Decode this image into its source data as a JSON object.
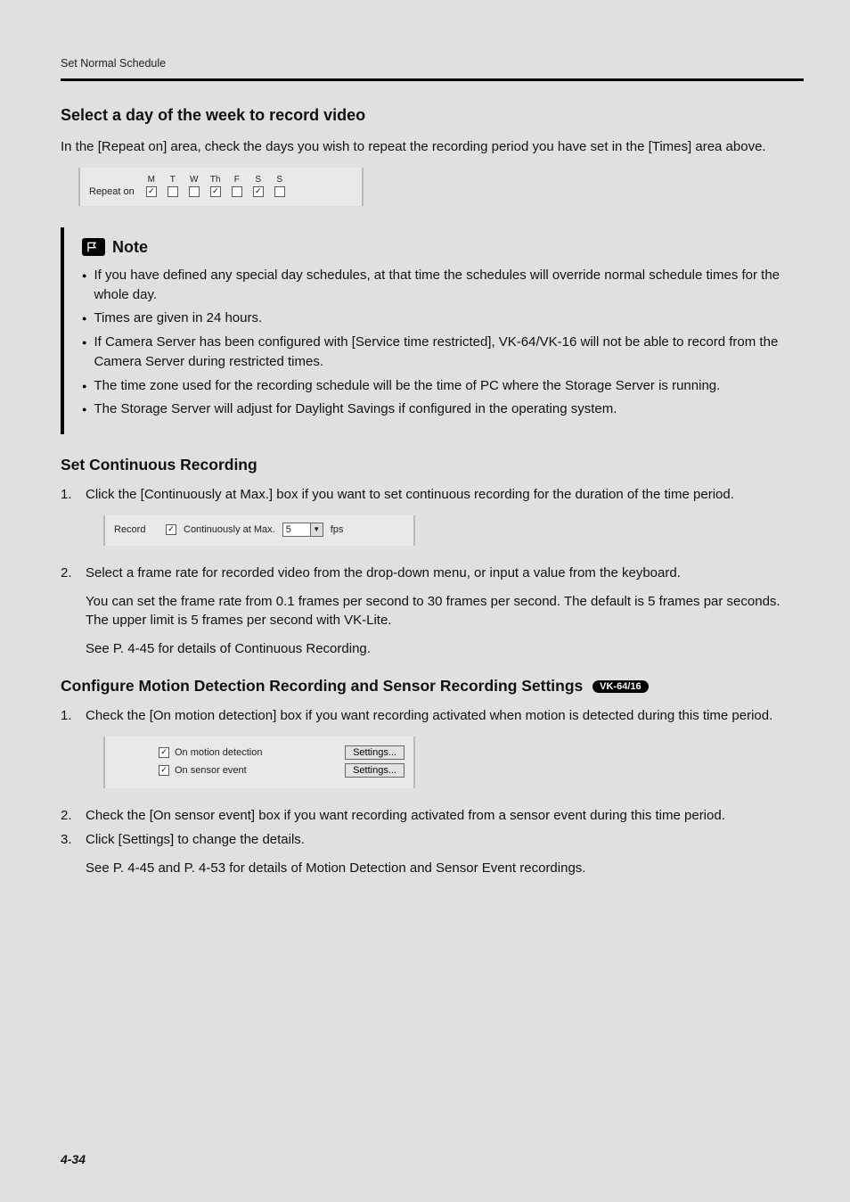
{
  "running_head": "Set Normal Schedule",
  "h_select_day": "Select a day of the week to record video",
  "p_select_day": "In the [Repeat on] area, check the days you wish to repeat the recording period you have set in the [Times] area above.",
  "repeat_shot": {
    "label": "Repeat on",
    "days": [
      {
        "abbr": "M",
        "checked": true
      },
      {
        "abbr": "T",
        "checked": false
      },
      {
        "abbr": "W",
        "checked": false
      },
      {
        "abbr": "Th",
        "checked": true
      },
      {
        "abbr": "F",
        "checked": false
      },
      {
        "abbr": "S",
        "checked": true
      },
      {
        "abbr": "S",
        "checked": false
      }
    ]
  },
  "note": {
    "title": "Note",
    "items": [
      "If you have defined any special day schedules, at that time the schedules will override normal schedule times for the whole day.",
      "Times are given in 24 hours.",
      "If Camera Server has been configured with [Service time restricted], VK-64/VK-16 will not be able to record from the Camera Server during restricted times.",
      "The time zone used for the recording schedule will be the time of PC where the Storage Server is running.",
      "The Storage Server will adjust for Daylight Savings if configured in the operating system."
    ]
  },
  "h_cont_rec": "Set Continuous Recording",
  "cont_steps": {
    "s1": "Click the [Continuously at Max.] box if you want to set continuous recording for the duration of the time period.",
    "s2": "Select a frame rate for recorded video from the drop-down menu, or input a value from the keyboard.",
    "s2_p1": "You can set the frame rate from 0.1 frames per second to 30 frames per second. The default is 5 frames par seconds. The upper limit is 5 frames per second with VK-Lite.",
    "s2_p2": "See P. 4-45 for details of Continuous Recording."
  },
  "record_shot": {
    "label": "Record",
    "checkbox_label": "Continuously at Max.",
    "checked": true,
    "fps_value": "5",
    "fps_unit": "fps"
  },
  "h_motion": "Configure Motion Detection Recording and Sensor Recording Settings",
  "badge": "VK-64/16",
  "motion_steps": {
    "s1": "Check the [On motion detection] box if you want recording activated when motion is detected during this time period.",
    "s2": "Check the [On sensor event] box if you want recording activated from a sensor event during this time period.",
    "s3": "Click [Settings] to change the details.",
    "s3_p1": "See P. 4-45 and P. 4-53 for details of Motion Detection and Sensor Event recordings."
  },
  "motion_shot": {
    "row1": {
      "label": "On motion detection",
      "checked": true,
      "btn": "Settings..."
    },
    "row2": {
      "label": "On sensor event",
      "checked": true,
      "btn": "Settings..."
    }
  },
  "page_number": "4-34"
}
